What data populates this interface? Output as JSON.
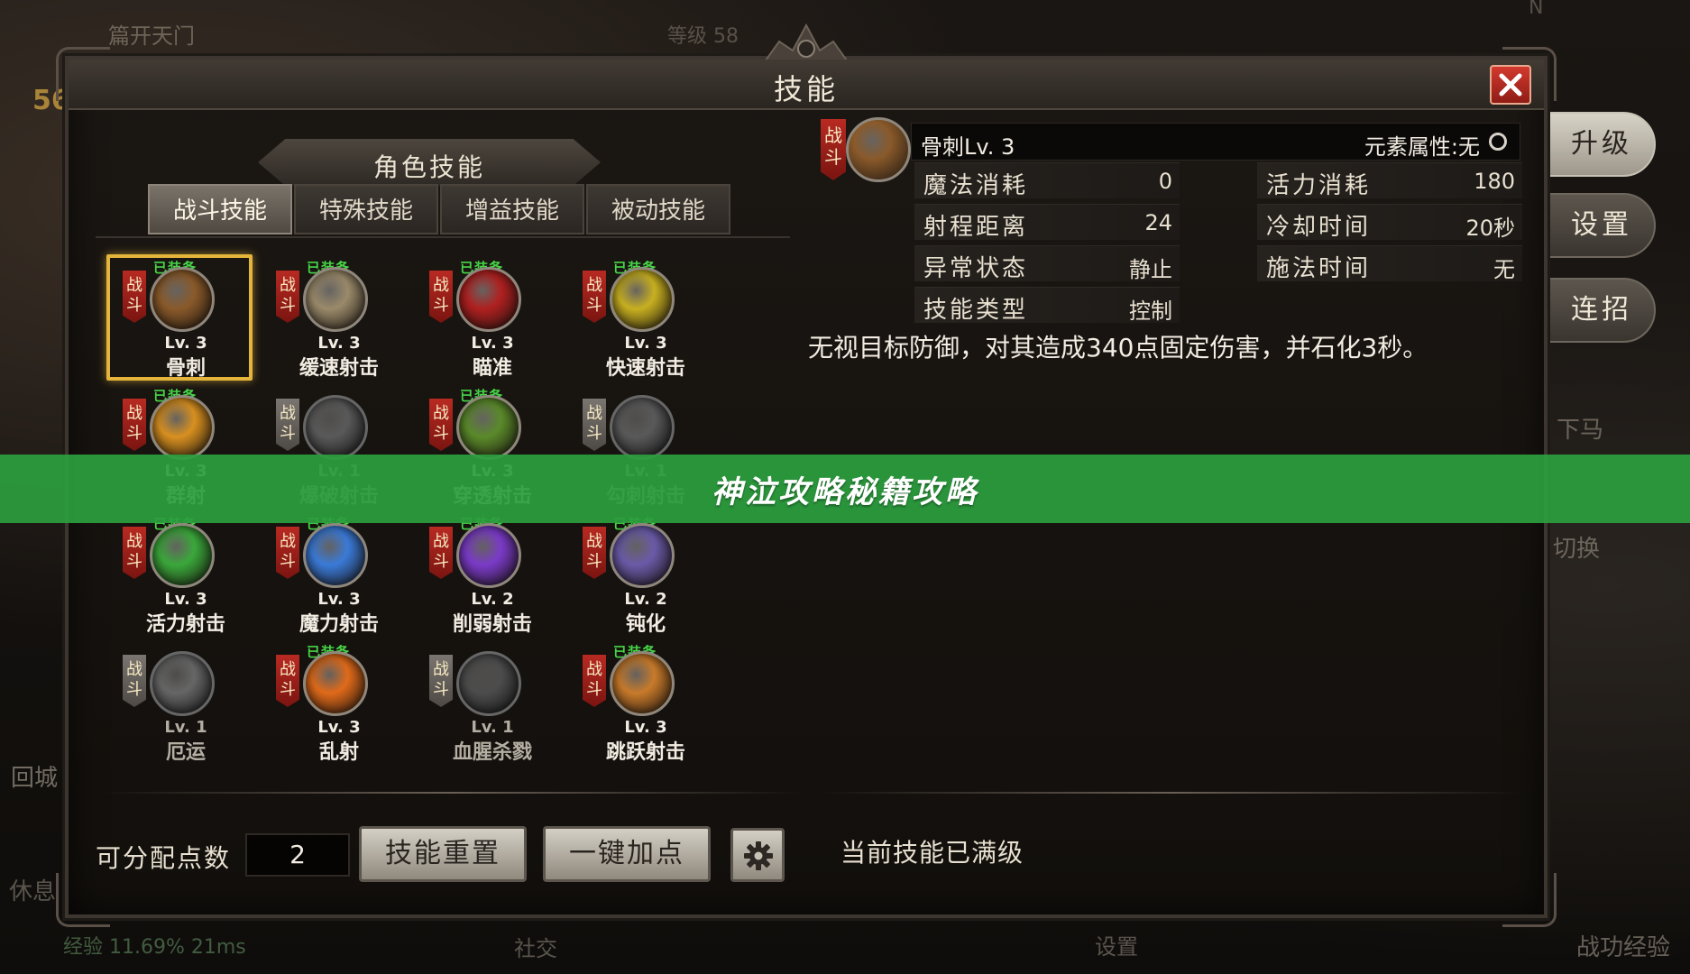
{
  "background": {
    "top_title": "篇开天门",
    "top_level": "等级 58",
    "top_n": "N",
    "left_level": "56",
    "left_return": "回城",
    "left_rest": "休息",
    "bottom_exp": "经验 11.69%  21ms",
    "bottom_social": "社交",
    "bottom_settings": "设置",
    "bottom_merit": "战功经验",
    "right_dismount": "下马",
    "right_switch": "切换"
  },
  "side_menu": {
    "upgrade": "升级",
    "settings": "设置",
    "combo": "连招"
  },
  "window": {
    "title": "技能",
    "section_title": "角色技能",
    "tabs": [
      "战斗技能",
      "特殊技能",
      "增益技能",
      "被动技能"
    ],
    "active_tab": 0
  },
  "skills": [
    {
      "name": "骨刺",
      "level": "Lv. 3",
      "tag": "战\n斗",
      "equipped": "已装备",
      "unlocked": true,
      "selected": true,
      "color": "#8a5a2a"
    },
    {
      "name": "缓速射击",
      "level": "Lv. 3",
      "tag": "战\n斗",
      "equipped": "已装备",
      "unlocked": true,
      "color": "#9a8a6a"
    },
    {
      "name": "瞄准",
      "level": "Lv. 3",
      "tag": "战\n斗",
      "equipped": "已装备",
      "unlocked": true,
      "color": "#b02020"
    },
    {
      "name": "快速射击",
      "level": "Lv. 3",
      "tag": "战\n斗",
      "equipped": "已装备",
      "unlocked": true,
      "color": "#c8b020"
    },
    {
      "name": "群射",
      "level": "Lv. 3",
      "tag": "战\n斗",
      "equipped": "已装备",
      "unlocked": true,
      "color": "#d89020"
    },
    {
      "name": "爆破射击",
      "level": "Lv. 1",
      "tag": "战\n斗",
      "equipped": "",
      "unlocked": false,
      "color": "#777777"
    },
    {
      "name": "穿透射击",
      "level": "Lv. 3",
      "tag": "战\n斗",
      "equipped": "已装备",
      "unlocked": true,
      "color": "#5a8a2a"
    },
    {
      "name": "勾刺射击",
      "level": "Lv. 1",
      "tag": "战\n斗",
      "equipped": "",
      "unlocked": false,
      "color": "#777777"
    },
    {
      "name": "活力射击",
      "level": "Lv. 3",
      "tag": "战\n斗",
      "equipped": "已装备",
      "unlocked": true,
      "color": "#3aa83a"
    },
    {
      "name": "魔力射击",
      "level": "Lv. 3",
      "tag": "战\n斗",
      "equipped": "已装备",
      "unlocked": true,
      "color": "#3a7ad8"
    },
    {
      "name": "削弱射击",
      "level": "Lv. 2",
      "tag": "战\n斗",
      "equipped": "已装备",
      "unlocked": true,
      "color": "#7a3ac8"
    },
    {
      "name": "钝化",
      "level": "Lv. 2",
      "tag": "战\n斗",
      "equipped": "已装备",
      "unlocked": true,
      "color": "#6a5aa8"
    },
    {
      "name": "厄运",
      "level": "Lv. 1",
      "tag": "战\n斗",
      "equipped": "",
      "unlocked": false,
      "color": "#888888"
    },
    {
      "name": "乱射",
      "level": "Lv. 3",
      "tag": "战\n斗",
      "equipped": "已装备",
      "unlocked": true,
      "color": "#e06a1a"
    },
    {
      "name": "血腥杀戮",
      "level": "Lv. 1",
      "tag": "战\n斗",
      "equipped": "",
      "unlocked": false,
      "color": "#666666"
    },
    {
      "name": "跳跃射击",
      "level": "Lv. 3",
      "tag": "战\n斗",
      "equipped": "已装备",
      "unlocked": true,
      "color": "#c87a2a"
    }
  ],
  "detail": {
    "tag": "战\n斗",
    "name": "骨刺Lv. 3",
    "element": "元素属性:无",
    "stats_left": [
      {
        "key": "魔法消耗",
        "value": "0"
      },
      {
        "key": "射程距离",
        "value": "24"
      },
      {
        "key": "异常状态",
        "value": "静止"
      },
      {
        "key": "技能类型",
        "value": "控制"
      }
    ],
    "stats_right": [
      {
        "key": "活力消耗",
        "value": "180"
      },
      {
        "key": "冷却时间",
        "value": "20秒"
      },
      {
        "key": "施法时间",
        "value": "无"
      }
    ],
    "description": "无视目标防御，对其造成340点固定伤害，并石化3秒。",
    "max_status": "当前技能已满级"
  },
  "footer": {
    "points_label": "可分配点数",
    "points_value": "2",
    "reset_label": "技能重置",
    "auto_label": "一键加点"
  },
  "overlay": {
    "text": "神泣攻略秘籍攻略",
    "color": "#2c9e3e"
  }
}
